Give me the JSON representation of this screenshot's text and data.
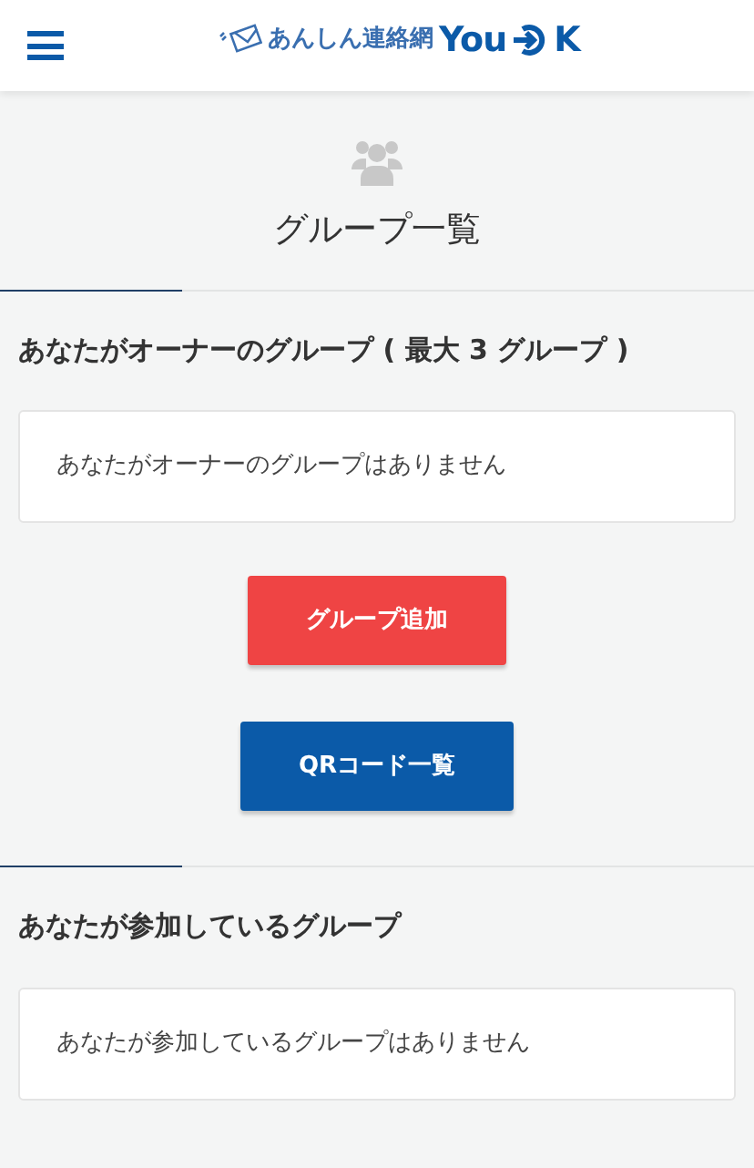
{
  "header": {
    "logo": {
      "name": "あんしん連絡網",
      "you": "You",
      "k": "K"
    }
  },
  "page": {
    "title": "グループ一覧"
  },
  "sections": [
    {
      "heading": "あなたがオーナーのグループ ( 最大 3 グループ )",
      "empty_message": "あなたがオーナーのグループはありません",
      "buttons": [
        {
          "label": "グループ追加",
          "kind": "danger"
        },
        {
          "label": "QRコード一覧",
          "kind": "primary"
        }
      ]
    },
    {
      "heading": "あなたが参加しているグループ",
      "empty_message": "あなたが参加しているグループはありません"
    }
  ]
}
